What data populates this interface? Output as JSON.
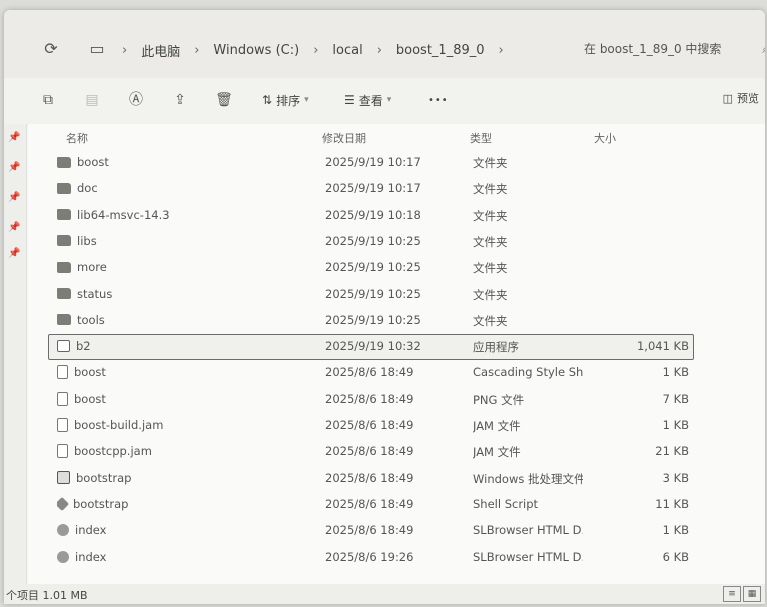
{
  "breadcrumb": [
    "此电脑",
    "Windows (C:)",
    "local",
    "boost_1_89_0"
  ],
  "search": {
    "placeholder": "在 boost_1_89_0 中搜索"
  },
  "toolbar": {
    "sort_label": "排序",
    "view_label": "查看",
    "more_label": "•••",
    "preview_label": "预览"
  },
  "columns": {
    "name": "名称",
    "date": "修改日期",
    "type": "类型",
    "size": "大小"
  },
  "files": [
    {
      "name": "boost",
      "date": "2025/9/19 10:17",
      "type": "文件夹",
      "size": "",
      "icon": "folder-icon"
    },
    {
      "name": "doc",
      "date": "2025/9/19 10:17",
      "type": "文件夹",
      "size": "",
      "icon": "folder-icon"
    },
    {
      "name": "lib64-msvc-14.3",
      "date": "2025/9/19 10:18",
      "type": "文件夹",
      "size": "",
      "icon": "folder-icon"
    },
    {
      "name": "libs",
      "date": "2025/9/19 10:25",
      "type": "文件夹",
      "size": "",
      "icon": "folder-icon"
    },
    {
      "name": "more",
      "date": "2025/9/19 10:25",
      "type": "文件夹",
      "size": "",
      "icon": "folder-icon"
    },
    {
      "name": "status",
      "date": "2025/9/19 10:25",
      "type": "文件夹",
      "size": "",
      "icon": "folder-icon"
    },
    {
      "name": "tools",
      "date": "2025/9/19 10:25",
      "type": "文件夹",
      "size": "",
      "icon": "folder-icon"
    },
    {
      "name": "b2",
      "date": "2025/9/19 10:32",
      "type": "应用程序",
      "size": "1,041 KB",
      "icon": "application-icon",
      "selected": true
    },
    {
      "name": "boost",
      "date": "2025/8/6 18:49",
      "type": "Cascading Style Sh...",
      "size": "1 KB",
      "icon": "document-icon"
    },
    {
      "name": "boost",
      "date": "2025/8/6 18:49",
      "type": "PNG 文件",
      "size": "7 KB",
      "icon": "document-icon"
    },
    {
      "name": "boost-build.jam",
      "date": "2025/8/6 18:49",
      "type": "JAM 文件",
      "size": "1 KB",
      "icon": "document-icon"
    },
    {
      "name": "boostcpp.jam",
      "date": "2025/8/6 18:49",
      "type": "JAM 文件",
      "size": "21 KB",
      "icon": "document-icon"
    },
    {
      "name": "bootstrap",
      "date": "2025/8/6 18:49",
      "type": "Windows 批处理文件",
      "size": "3 KB",
      "icon": "batch-file-icon"
    },
    {
      "name": "bootstrap",
      "date": "2025/8/6 18:49",
      "type": "Shell Script",
      "size": "11 KB",
      "icon": "shell-script-icon"
    },
    {
      "name": "index",
      "date": "2025/8/6 18:49",
      "type": "SLBrowser HTML D...",
      "size": "1 KB",
      "icon": "browser-html-icon"
    },
    {
      "name": "index",
      "date": "2025/8/6 19:26",
      "type": "SLBrowser HTML D...",
      "size": "6 KB",
      "icon": "browser-html-icon"
    }
  ],
  "status": {
    "text": "个项目 1.01 MB"
  }
}
